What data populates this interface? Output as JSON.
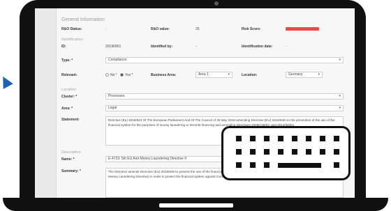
{
  "form": {
    "section_general": "General Information",
    "rao_status_label": "R&O Status:",
    "rao_status_value": "-",
    "rao_value_label": "R&O value:",
    "rao_value_value": "25",
    "risk_score_label": "Risk Score:",
    "risk_score_color": "#e94a4a",
    "identification_heading": "Identification",
    "id_label": "ID:",
    "id_value": "20190001",
    "identified_by_label": "Identified by:",
    "identified_by_value": "-",
    "identification_date_label": "Identification date:",
    "identification_date_value": "-",
    "type_label": "Type: *",
    "type_value": "Compliance",
    "relevant_label": "Relevant:",
    "relevant_no": "No *",
    "relevant_yes": "Yes *",
    "relevant_selected": "Yes",
    "business_area_label": "Business Area:",
    "business_area_value": "Area 1",
    "location_label": "Location:",
    "location_value": "Germany",
    "location_heading": "Location",
    "cluster_label": "Cluster: *",
    "cluster_value": "Processes",
    "area_label": "Area: *",
    "area_value": "Legal",
    "statement_label": "Statement:",
    "statement_value": "Directive (Eu) 2018/843 Of The European Parliament And Of The Council of 30 May 2018 amending Directive (EU) 2015/849 on the prevention of the use of the financial system for the purposes of money laundering or terrorist financing and amending Directives 2009/138/EC and 2013/36/EU",
    "description_heading": "Description",
    "name_label": "Name: *",
    "name_value": "E-4723: 5th EU Anti-Money Laundering Directive II",
    "summary_label": "Summary: *",
    "summary_value": "The Directive amends Directive (EU) 2015/849 to prevent the use of the financial system for the purpose of money laundering and terrorism financing (4th Anti-Money Laundering Directive) in order to protect the financial system against money laundering and terrorism financing."
  },
  "colors": {
    "accent_arrow": "#1d63b0",
    "laptop_frame": "#111111",
    "redaction": "#111111"
  }
}
